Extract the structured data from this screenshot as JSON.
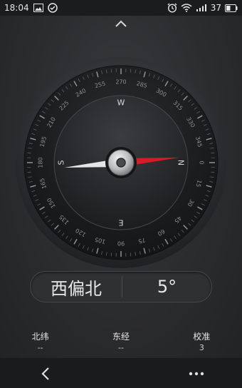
{
  "status_bar": {
    "time": "18:04",
    "battery_level": "37",
    "icons": [
      "image-icon",
      "check-circle-icon",
      "alarm-clock-icon",
      "wifi-icon",
      "signal-icon",
      "battery-icon"
    ]
  },
  "compass": {
    "cardinals": [
      "N",
      "E",
      "S",
      "W"
    ],
    "degree_labels": [
      "0",
      "15",
      "30",
      "45",
      "60",
      "75",
      "90",
      "105",
      "120",
      "135",
      "150",
      "165",
      "180",
      "195",
      "210",
      "225",
      "240",
      "255",
      "270",
      "285",
      "300",
      "315",
      "330",
      "345"
    ],
    "needle_bearing": 5,
    "colors": {
      "north_needle": "#d21d26",
      "south_needle": "#e6e6e6"
    }
  },
  "heading": {
    "direction": "西偏北",
    "degrees": "5°"
  },
  "info": {
    "latitude_label": "北纬",
    "latitude_value": "--",
    "longitude_label": "东经",
    "longitude_value": "--",
    "calibration_label": "校准",
    "calibration_value": "3"
  },
  "nav": {
    "icons": [
      "back-chevron-icon",
      "more-dots-icon"
    ]
  }
}
